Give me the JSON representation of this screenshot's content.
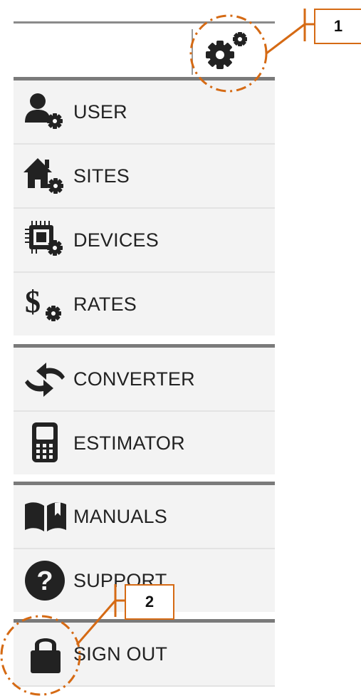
{
  "menu": {
    "items": [
      {
        "label": "USER",
        "icon": "user-settings-icon"
      },
      {
        "label": "SITES",
        "icon": "home-settings-icon"
      },
      {
        "label": "DEVICES",
        "icon": "device-settings-icon"
      },
      {
        "label": "RATES",
        "icon": "dollar-settings-icon"
      },
      {
        "label": "CONVERTER",
        "icon": "convert-arrows-icon"
      },
      {
        "label": "ESTIMATOR",
        "icon": "calculator-icon"
      },
      {
        "label": "MANUALS",
        "icon": "book-icon"
      },
      {
        "label": "SUPPORT",
        "icon": "question-icon"
      },
      {
        "label": "SIGN OUT",
        "icon": "lock-icon"
      }
    ]
  },
  "header": {
    "settings_icon": "gears-icon"
  },
  "callouts": {
    "one": "1",
    "two": "2"
  },
  "colors": {
    "accent": "#d56a14",
    "icon": "#222222",
    "menu_bg": "#f3f3f3",
    "divider": "#7a7a7a"
  }
}
